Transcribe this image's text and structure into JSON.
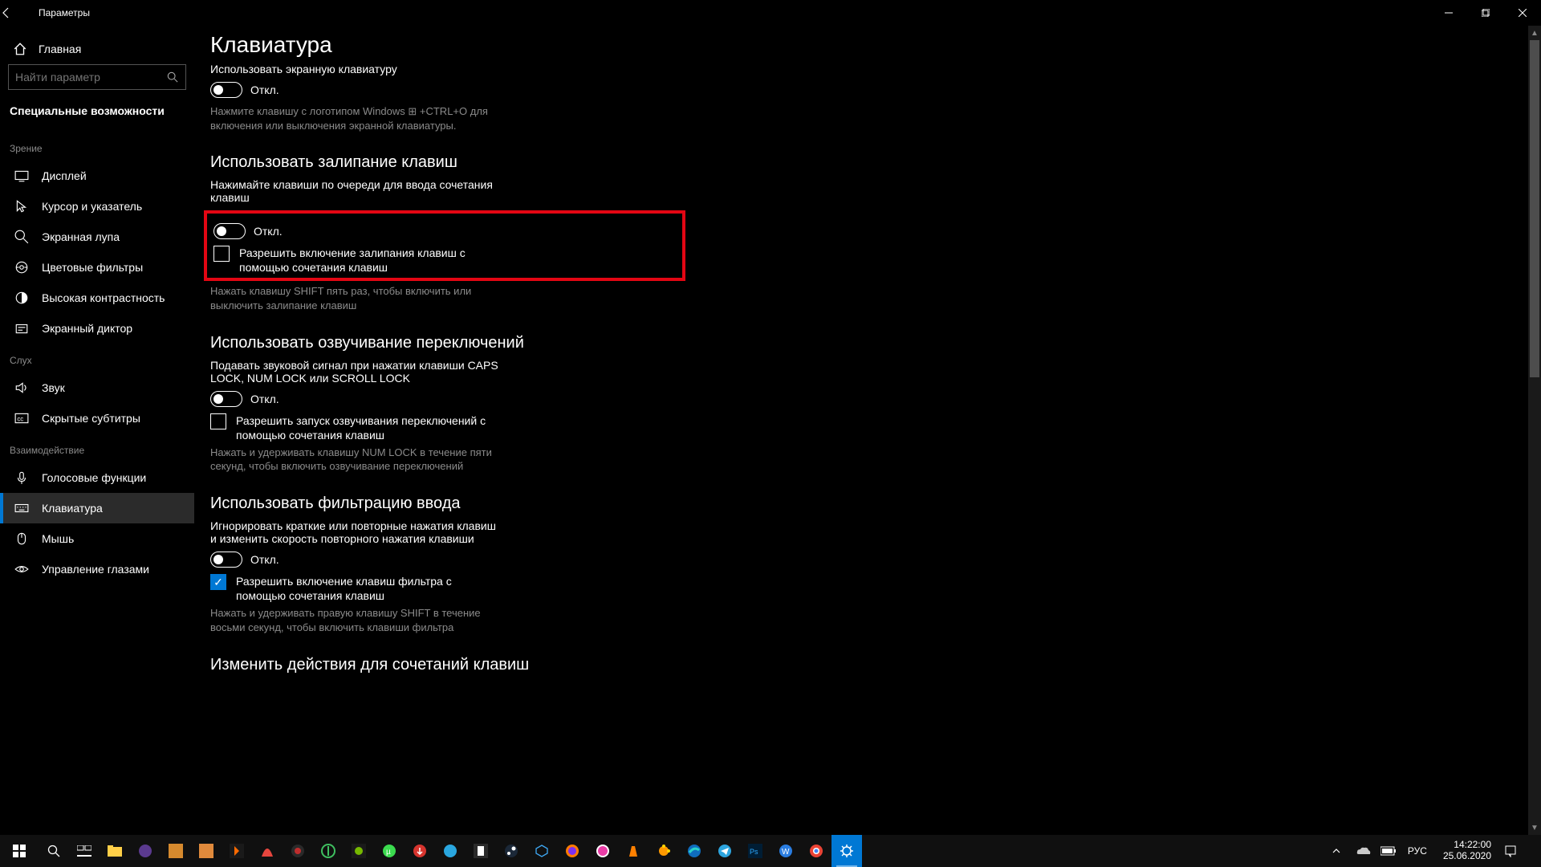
{
  "window": {
    "title": "Параметры"
  },
  "sidebar": {
    "home": "Главная",
    "search_placeholder": "Найти параметр",
    "breadcrumb": "Специальные возможности",
    "groups": [
      {
        "label": "Зрение",
        "items": [
          {
            "icon": "display",
            "label": "Дисплей"
          },
          {
            "icon": "cursor",
            "label": "Курсор и указатель"
          },
          {
            "icon": "magnifier",
            "label": "Экранная лупа"
          },
          {
            "icon": "color",
            "label": "Цветовые фильтры"
          },
          {
            "icon": "contrast",
            "label": "Высокая контрастность"
          },
          {
            "icon": "narrator",
            "label": "Экранный диктор"
          }
        ]
      },
      {
        "label": "Слух",
        "items": [
          {
            "icon": "audio",
            "label": "Звук"
          },
          {
            "icon": "cc",
            "label": "Скрытые субтитры"
          }
        ]
      },
      {
        "label": "Взаимодействие",
        "items": [
          {
            "icon": "mic",
            "label": "Голосовые функции"
          },
          {
            "icon": "keyboard",
            "label": "Клавиатура",
            "selected": true
          },
          {
            "icon": "mouse",
            "label": "Мышь"
          },
          {
            "icon": "eye",
            "label": "Управление глазами"
          }
        ]
      }
    ]
  },
  "content": {
    "page_title": "Клавиатура",
    "s0": {
      "desc": "Использовать экранную клавиатуру",
      "toggle_state": "Откл.",
      "hint": "Нажмите клавишу с логотипом Windows ⊞ +CTRL+O для включения или выключения экранной клавиатуры."
    },
    "s1": {
      "heading": "Использовать залипание клавиш",
      "desc": "Нажимайте клавиши по очереди для ввода сочетания клавиш",
      "toggle_state": "Откл.",
      "check_label": "Разрешить включение залипания клавиш с помощью сочетания клавиш",
      "hint": "Нажать клавишу SHIFT пять раз, чтобы включить или выключить залипание клавиш"
    },
    "s2": {
      "heading": "Использовать озвучивание переключений",
      "desc": "Подавать звуковой сигнал при нажатии клавиши CAPS LOCK, NUM LOCK или SCROLL LOCK",
      "toggle_state": "Откл.",
      "check_label": "Разрешить запуск озвучивания переключений с помощью сочетания клавиш",
      "hint": "Нажать и удерживать клавишу NUM LOCK в течение пяти секунд, чтобы включить озвучивание переключений"
    },
    "s3": {
      "heading": "Использовать фильтрацию ввода",
      "desc": "Игнорировать краткие или повторные нажатия клавиш и изменить скорость повторного нажатия клавиши",
      "toggle_state": "Откл.",
      "check_label": "Разрешить включение клавиш фильтра с помощью сочетания клавиш",
      "hint": "Нажать и удерживать правую клавишу SHIFT в течение восьми секунд, чтобы включить клавиши фильтра"
    },
    "s4": {
      "heading": "Изменить действия для сочетаний клавиш"
    }
  },
  "taskbar": {
    "lang": "РУС",
    "time": "14:22:00",
    "date": "25.06.2020"
  }
}
